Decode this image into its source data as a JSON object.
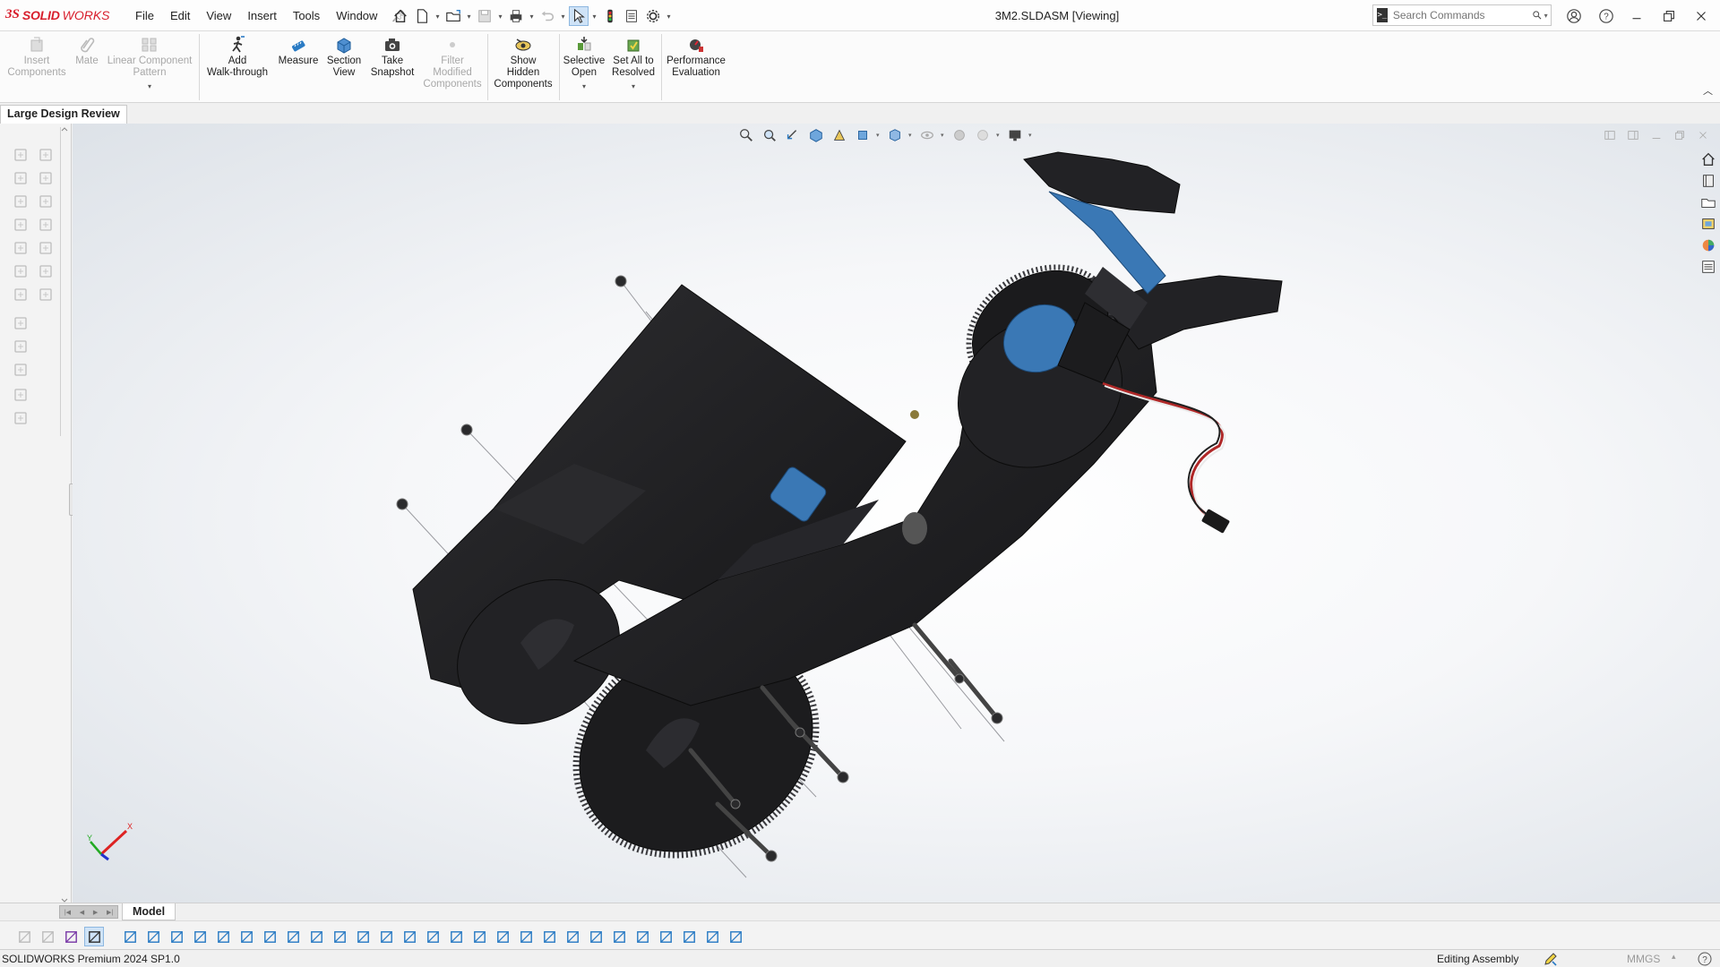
{
  "app": {
    "brand_ds": "3S",
    "brand_solid": "SOLID",
    "brand_works": "WORKS",
    "document_title": "3M2.SLDASM [Viewing]"
  },
  "menu": [
    "File",
    "Edit",
    "View",
    "Insert",
    "Tools",
    "Window"
  ],
  "search": {
    "placeholder": "Search Commands"
  },
  "ribbon": {
    "insert_components": "Insert\nComponents",
    "mate": "Mate",
    "linear_pattern": "Linear Component\nPattern",
    "add_walkthrough": "Add\nWalk-through",
    "measure": "Measure",
    "section_view": "Section\nView",
    "take_snapshot": "Take\nSnapshot",
    "filter_modified": "Filter\nModified\nComponents",
    "show_hidden": "Show\nHidden\nComponents",
    "selective_open": "Selective\nOpen",
    "set_all_resolved": "Set All to\nResolved",
    "performance_evaluation": "Performance\nEvaluation"
  },
  "tabs": {
    "large_design_review": "Large Design Review"
  },
  "bottom_tabs": {
    "model": "Model"
  },
  "status": {
    "product": "SOLIDWORKS Premium 2024 SP1.0",
    "mode": "Editing Assembly",
    "units": "MMGS"
  },
  "colors": {
    "brand_red": "#d81e2c",
    "accent_blue": "#2a7bc4",
    "part_black": "#1c1c1e",
    "part_blue": "#3a78b5"
  }
}
